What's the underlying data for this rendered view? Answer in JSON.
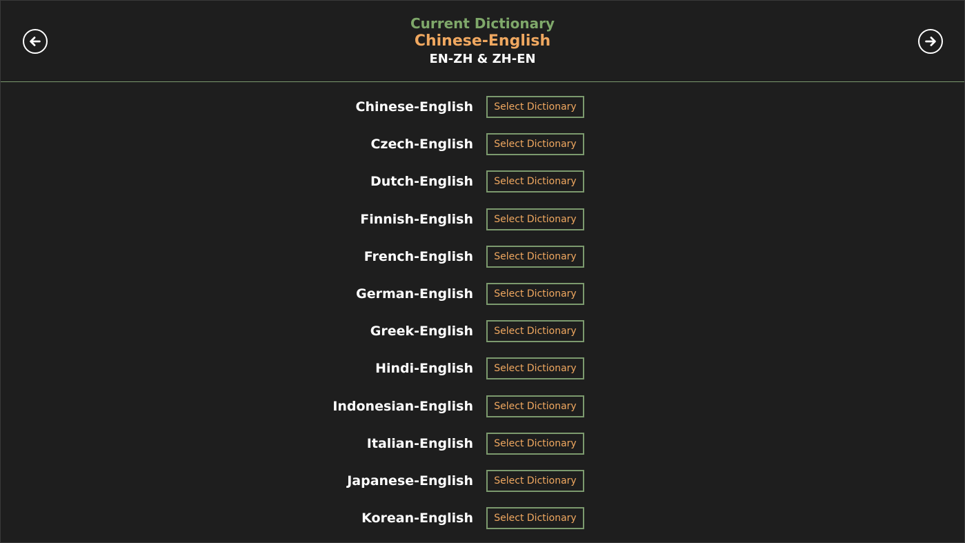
{
  "header": {
    "back_icon": "arrow-left-circle-icon",
    "forward_icon": "arrow-right-circle-icon",
    "current_label": "Current Dictionary",
    "current_dictionary": "Chinese-English",
    "current_directions": "EN-ZH & ZH-EN"
  },
  "dictionaries": [
    {
      "name": "Chinese-English",
      "button": "Select Dictionary"
    },
    {
      "name": "Czech-English",
      "button": "Select Dictionary"
    },
    {
      "name": "Dutch-English",
      "button": "Select Dictionary"
    },
    {
      "name": "Finnish-English",
      "button": "Select Dictionary"
    },
    {
      "name": "French-English",
      "button": "Select Dictionary"
    },
    {
      "name": "German-English",
      "button": "Select Dictionary"
    },
    {
      "name": "Greek-English",
      "button": "Select Dictionary"
    },
    {
      "name": "Hindi-English",
      "button": "Select Dictionary"
    },
    {
      "name": "Indonesian-English",
      "button": "Select Dictionary"
    },
    {
      "name": "Italian-English",
      "button": "Select Dictionary"
    },
    {
      "name": "Japanese-English",
      "button": "Select Dictionary"
    },
    {
      "name": "Korean-English",
      "button": "Select Dictionary"
    }
  ],
  "colors": {
    "background": "#1e1e1e",
    "accent_green": "#7c9a6e",
    "label_green": "#7fa86a",
    "accent_orange": "#f0a860",
    "text_white": "#ffffff"
  }
}
